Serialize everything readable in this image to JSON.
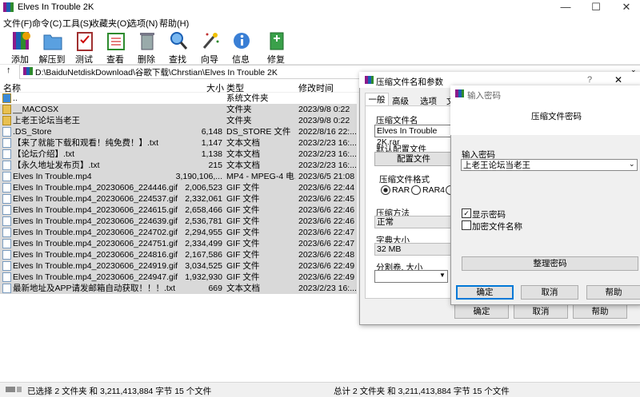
{
  "window": {
    "title": "Elves In Trouble 2K",
    "min": "—",
    "max": "☐",
    "close": "✕"
  },
  "menu": [
    "文件(F)",
    "命令(C)",
    "工具(S)",
    "收藏夹(O)",
    "选项(N)",
    "帮助(H)"
  ],
  "toolbar": [
    "添加",
    "解压到",
    "测试",
    "查看",
    "删除",
    "查找",
    "向导",
    "信息",
    "修复"
  ],
  "address": {
    "path": "D:\\BaiduNetdiskDownload\\谷歌下载\\Chrstian\\Elves In Trouble 2K"
  },
  "columns": {
    "name": "名称",
    "size": "大小",
    "type": "类型",
    "date": "修改时间"
  },
  "files": [
    {
      "name": "..",
      "size": "",
      "type": "系统文件夹",
      "date": ""
    },
    {
      "name": "__MACOSX",
      "size": "",
      "type": "文件夹",
      "date": "2023/9/8 0:22"
    },
    {
      "name": "上老王论坛当老王",
      "size": "",
      "type": "文件夹",
      "date": "2023/9/8 0:22"
    },
    {
      "name": ".DS_Store",
      "size": "6,148",
      "type": "DS_STORE 文件",
      "date": "2022/8/16 22:..."
    },
    {
      "name": "【来了就能下载和观看！纯免费！】.txt",
      "size": "1,147",
      "type": "文本文档",
      "date": "2023/2/23 16:..."
    },
    {
      "name": "【论坛介绍】.txt",
      "size": "1,138",
      "type": "文本文档",
      "date": "2023/2/23 16:..."
    },
    {
      "name": "【永久地址发布页】.txt",
      "size": "215",
      "type": "文本文档",
      "date": "2023/2/23 16:..."
    },
    {
      "name": "Elves In Trouble.mp4",
      "size": "3,190,106,...",
      "type": "MP4 - MPEG-4 电...",
      "date": "2023/6/5 21:08"
    },
    {
      "name": "Elves In Trouble.mp4_20230606_224446.gif",
      "size": "2,006,523",
      "type": "GIF 文件",
      "date": "2023/6/6 22:44"
    },
    {
      "name": "Elves In Trouble.mp4_20230606_224537.gif",
      "size": "2,332,061",
      "type": "GIF 文件",
      "date": "2023/6/6 22:45"
    },
    {
      "name": "Elves In Trouble.mp4_20230606_224615.gif",
      "size": "2,658,466",
      "type": "GIF 文件",
      "date": "2023/6/6 22:46"
    },
    {
      "name": "Elves In Trouble.mp4_20230606_224639.gif",
      "size": "2,536,781",
      "type": "GIF 文件",
      "date": "2023/6/6 22:46"
    },
    {
      "name": "Elves In Trouble.mp4_20230606_224702.gif",
      "size": "2,294,955",
      "type": "GIF 文件",
      "date": "2023/6/6 22:47"
    },
    {
      "name": "Elves In Trouble.mp4_20230606_224751.gif",
      "size": "2,334,499",
      "type": "GIF 文件",
      "date": "2023/6/6 22:47"
    },
    {
      "name": "Elves In Trouble.mp4_20230606_224816.gif",
      "size": "2,167,586",
      "type": "GIF 文件",
      "date": "2023/6/6 22:48"
    },
    {
      "name": "Elves In Trouble.mp4_20230606_224919.gif",
      "size": "3,034,525",
      "type": "GIF 文件",
      "date": "2023/6/6 22:49"
    },
    {
      "name": "Elves In Trouble.mp4_20230606_224947.gif",
      "size": "1,932,930",
      "type": "GIF 文件",
      "date": "2023/6/6 22:49"
    },
    {
      "name": "最新地址及APP请发邮箱自动获取！！！.txt",
      "size": "669",
      "type": "文本文档",
      "date": "2023/2/23 16:..."
    }
  ],
  "status": {
    "left": "已选择 2 文件夹 和 3,211,413,884 字节 15 个文件",
    "right": "总计 2 文件夹 和 3,211,413,884 字节 15 个文件"
  },
  "archive_dialog": {
    "title": "压缩文件名和参数",
    "help": "?",
    "close": "✕",
    "tabs": [
      "一般",
      "高级",
      "选项",
      "文"
    ],
    "archive_name_label": "压缩文件名",
    "archive_name": "Elves In Trouble 2K.rar",
    "profile_label": "默认配置文件",
    "profile_button": "配置文件",
    "format_label": "压缩文件格式",
    "format_rar": "RAR",
    "format_rar4": "RAR4",
    "method_label": "压缩方法",
    "method_value": "正常",
    "dict_label": "字典大小",
    "dict_value": "32 MB",
    "split_label": "分割卷, 大小",
    "ok": "确定",
    "cancel": "取消",
    "help_btn": "帮助"
  },
  "password_dialog": {
    "title": "输入密码",
    "heading": "压缩文件密码",
    "enter_label": "输入密码",
    "password_value": "上老王论坛当老王",
    "show_password": "显示密码",
    "show_checked": "✓",
    "encrypt_names": "加密文件名称",
    "organize": "整理密码",
    "ok": "确定",
    "cancel": "取消",
    "help": "帮助"
  },
  "colors": {
    "selection": "#d9d9d9",
    "dialog_bg": "#f0f0f0",
    "accent": "#0078d7"
  }
}
